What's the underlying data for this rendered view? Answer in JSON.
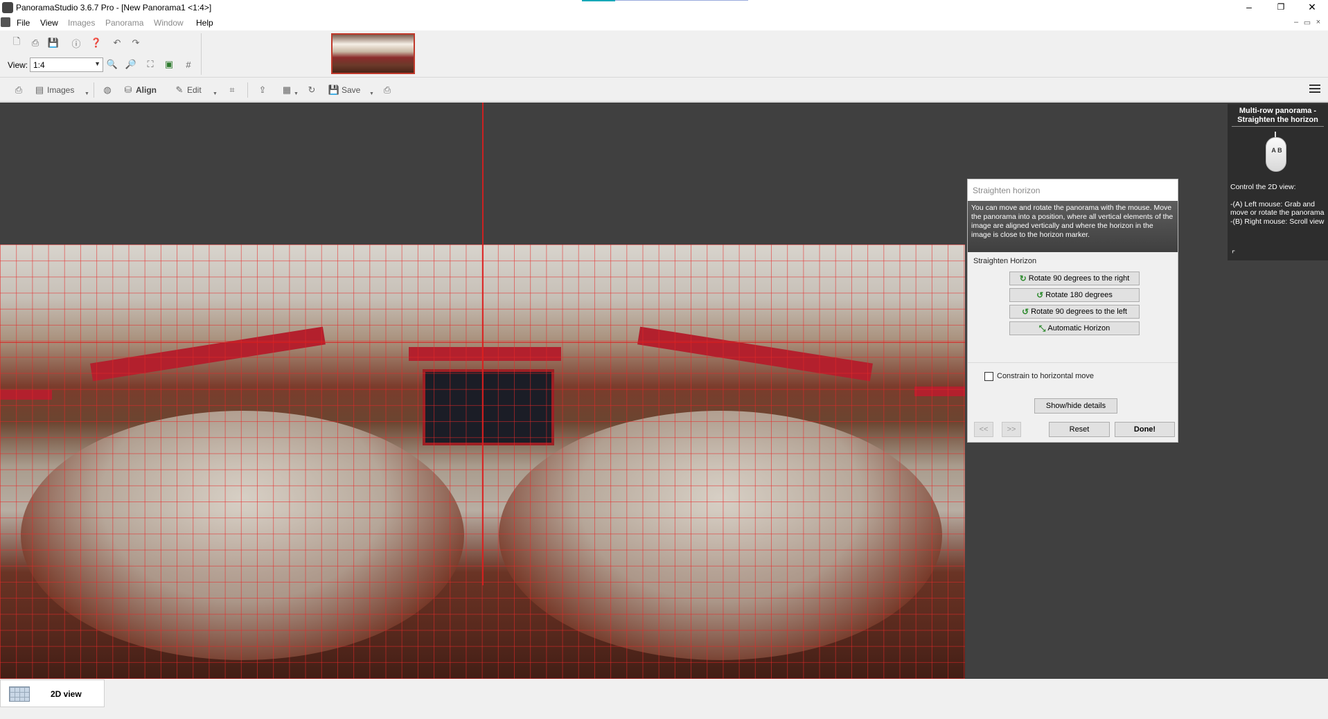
{
  "window": {
    "title": "PanoramaStudio 3.6.7 Pro - [New Panorama1 <1:4>]",
    "controls": {
      "minimize": "–",
      "maximize": "❐",
      "close": "✕"
    }
  },
  "menu": {
    "items": [
      "File",
      "View",
      "Images",
      "Panorama",
      "Window",
      "Help"
    ],
    "mdi_controls": {
      "minimize": "–",
      "restore": "▭",
      "close": "×"
    }
  },
  "toolbar1": {
    "view_label": "View:",
    "zoom_value": "1:4"
  },
  "toolbar2": {
    "images_label": "Images",
    "align_label": "Align",
    "edit_label": "Edit",
    "save_label": "Save"
  },
  "dialog": {
    "title": "Straighten horizon",
    "description": "You can move and rotate the panorama with the mouse. Move the panorama into a position, where all vertical elements of the image are aligned vertically and where the horizon in the image is close to the horizon marker.",
    "group_label": "Straighten Horizon",
    "buttons": [
      {
        "label": "Rotate 90 degrees to the right",
        "icon": "↻"
      },
      {
        "label": "Rotate 180 degrees",
        "icon": "↺"
      },
      {
        "label": "Rotate 90 degrees to the left",
        "icon": "↺"
      },
      {
        "label": "Automatic Horizon",
        "icon": "⤡"
      }
    ],
    "constrain_label": "Constrain to horizontal move",
    "constrain_checked": false,
    "details_label": "Show/hide details",
    "prev_label": "<<",
    "next_label": ">>",
    "reset_label": "Reset",
    "done_label": "Done!"
  },
  "help_panel": {
    "title": "Multi-row panorama - Straighten the horizon",
    "mouse_letters": "A B",
    "lines": [
      "Control the 2D view:",
      "-(A) Left mouse: Grab and move or rotate the panorama",
      "-(B) Right mouse: Scroll view"
    ]
  },
  "bottom_tab": {
    "label": "2D view"
  },
  "colors": {
    "grid": "#e62828",
    "canvas_bg": "#404040",
    "accent": "#18a8b8"
  }
}
